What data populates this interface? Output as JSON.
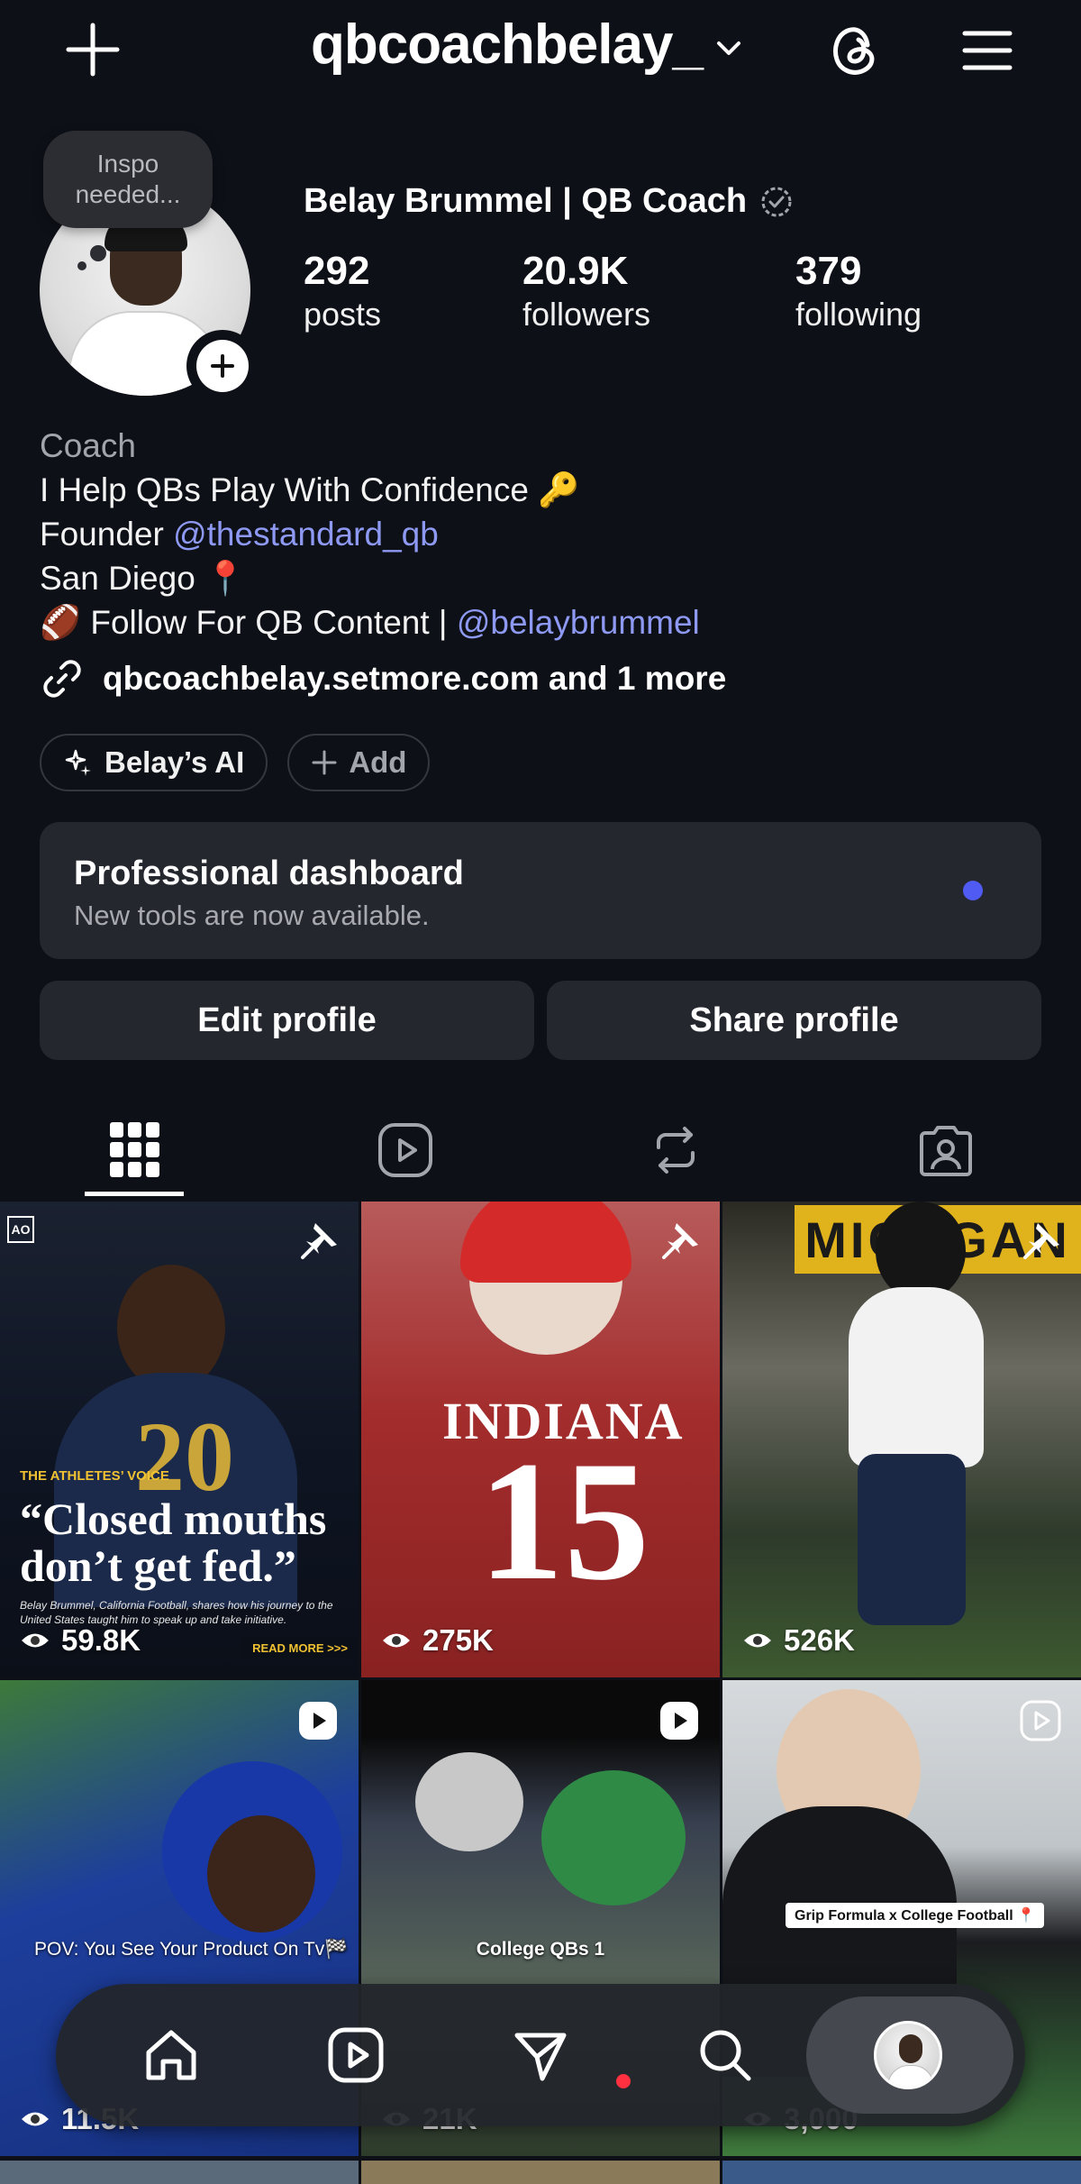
{
  "header": {
    "username": "qbcoachbelay_"
  },
  "profile": {
    "note": [
      "Inspo",
      "needed..."
    ],
    "display_name": "Belay Brummel | QB Coach",
    "stats": [
      {
        "value": "292",
        "label": "posts"
      },
      {
        "value": "20.9K",
        "label": "followers"
      },
      {
        "value": "379",
        "label": "following"
      }
    ],
    "bio": {
      "category": "Coach",
      "line1": "I Help QBs Play With Confidence 🔑",
      "line2_prefix": "Founder ",
      "line2_handle": "@thestandard_qb",
      "line3": "San Diego 📍",
      "line4_prefix": "🏈 Follow For QB Content | ",
      "line4_handle": "@belaybrummel"
    },
    "link_text": "qbcoachbelay.setmore.com and 1 more",
    "chips": [
      {
        "label": "Belay’s AI",
        "icon": "sparkle-ai-icon"
      },
      {
        "label": "Add",
        "icon": "plus-icon"
      }
    ]
  },
  "dashboard": {
    "title": "Professional dashboard",
    "subtitle": "New tools are now available."
  },
  "actions": {
    "edit": "Edit profile",
    "share": "Share profile"
  },
  "tabs": [
    {
      "icon": "grid-icon",
      "active": true
    },
    {
      "icon": "reels-icon",
      "active": false
    },
    {
      "icon": "reposts-icon",
      "active": false
    },
    {
      "icon": "tagged-icon",
      "active": false
    }
  ],
  "grid": {
    "posts": [
      {
        "views": "59.8K",
        "pinned": true,
        "type": "post",
        "brand": "AO",
        "label": "THE ATHLETES’ VOICE",
        "quote": "“Closed mouths don’t get fed.”",
        "small": "Belay Brummel, California Football, shares how his journey to the United States taught him to speak up and take initiative.",
        "readmore": "READ MORE >>>",
        "jersey_number": "20"
      },
      {
        "views": "275K",
        "pinned": true,
        "type": "post",
        "jersey_name": "INDIANA",
        "jersey_number": "15"
      },
      {
        "views": "526K",
        "pinned": true,
        "type": "post",
        "sign": "MICHGAN"
      },
      {
        "views": "11.5K",
        "pinned": false,
        "type": "reel",
        "caption": "POV: You See Your Product On Tv🏁"
      },
      {
        "views": "21K",
        "pinned": false,
        "type": "reel",
        "caption": "College QBs 1"
      },
      {
        "views": "3,000",
        "pinned": false,
        "type": "reel",
        "caption": "Grip Formula x College Football 📍"
      }
    ]
  },
  "bottom_nav": [
    {
      "icon": "home-icon"
    },
    {
      "icon": "reels-nav-icon"
    },
    {
      "icon": "direct-message-icon",
      "badge": true
    },
    {
      "icon": "search-icon"
    },
    {
      "icon": "profile-avatar-icon",
      "active": true
    }
  ],
  "colors": {
    "background": "#0d1017",
    "card": "#25272e",
    "link": "#8e99f3",
    "accent_dot": "#4f5bf2",
    "notification": "#ff3040"
  }
}
